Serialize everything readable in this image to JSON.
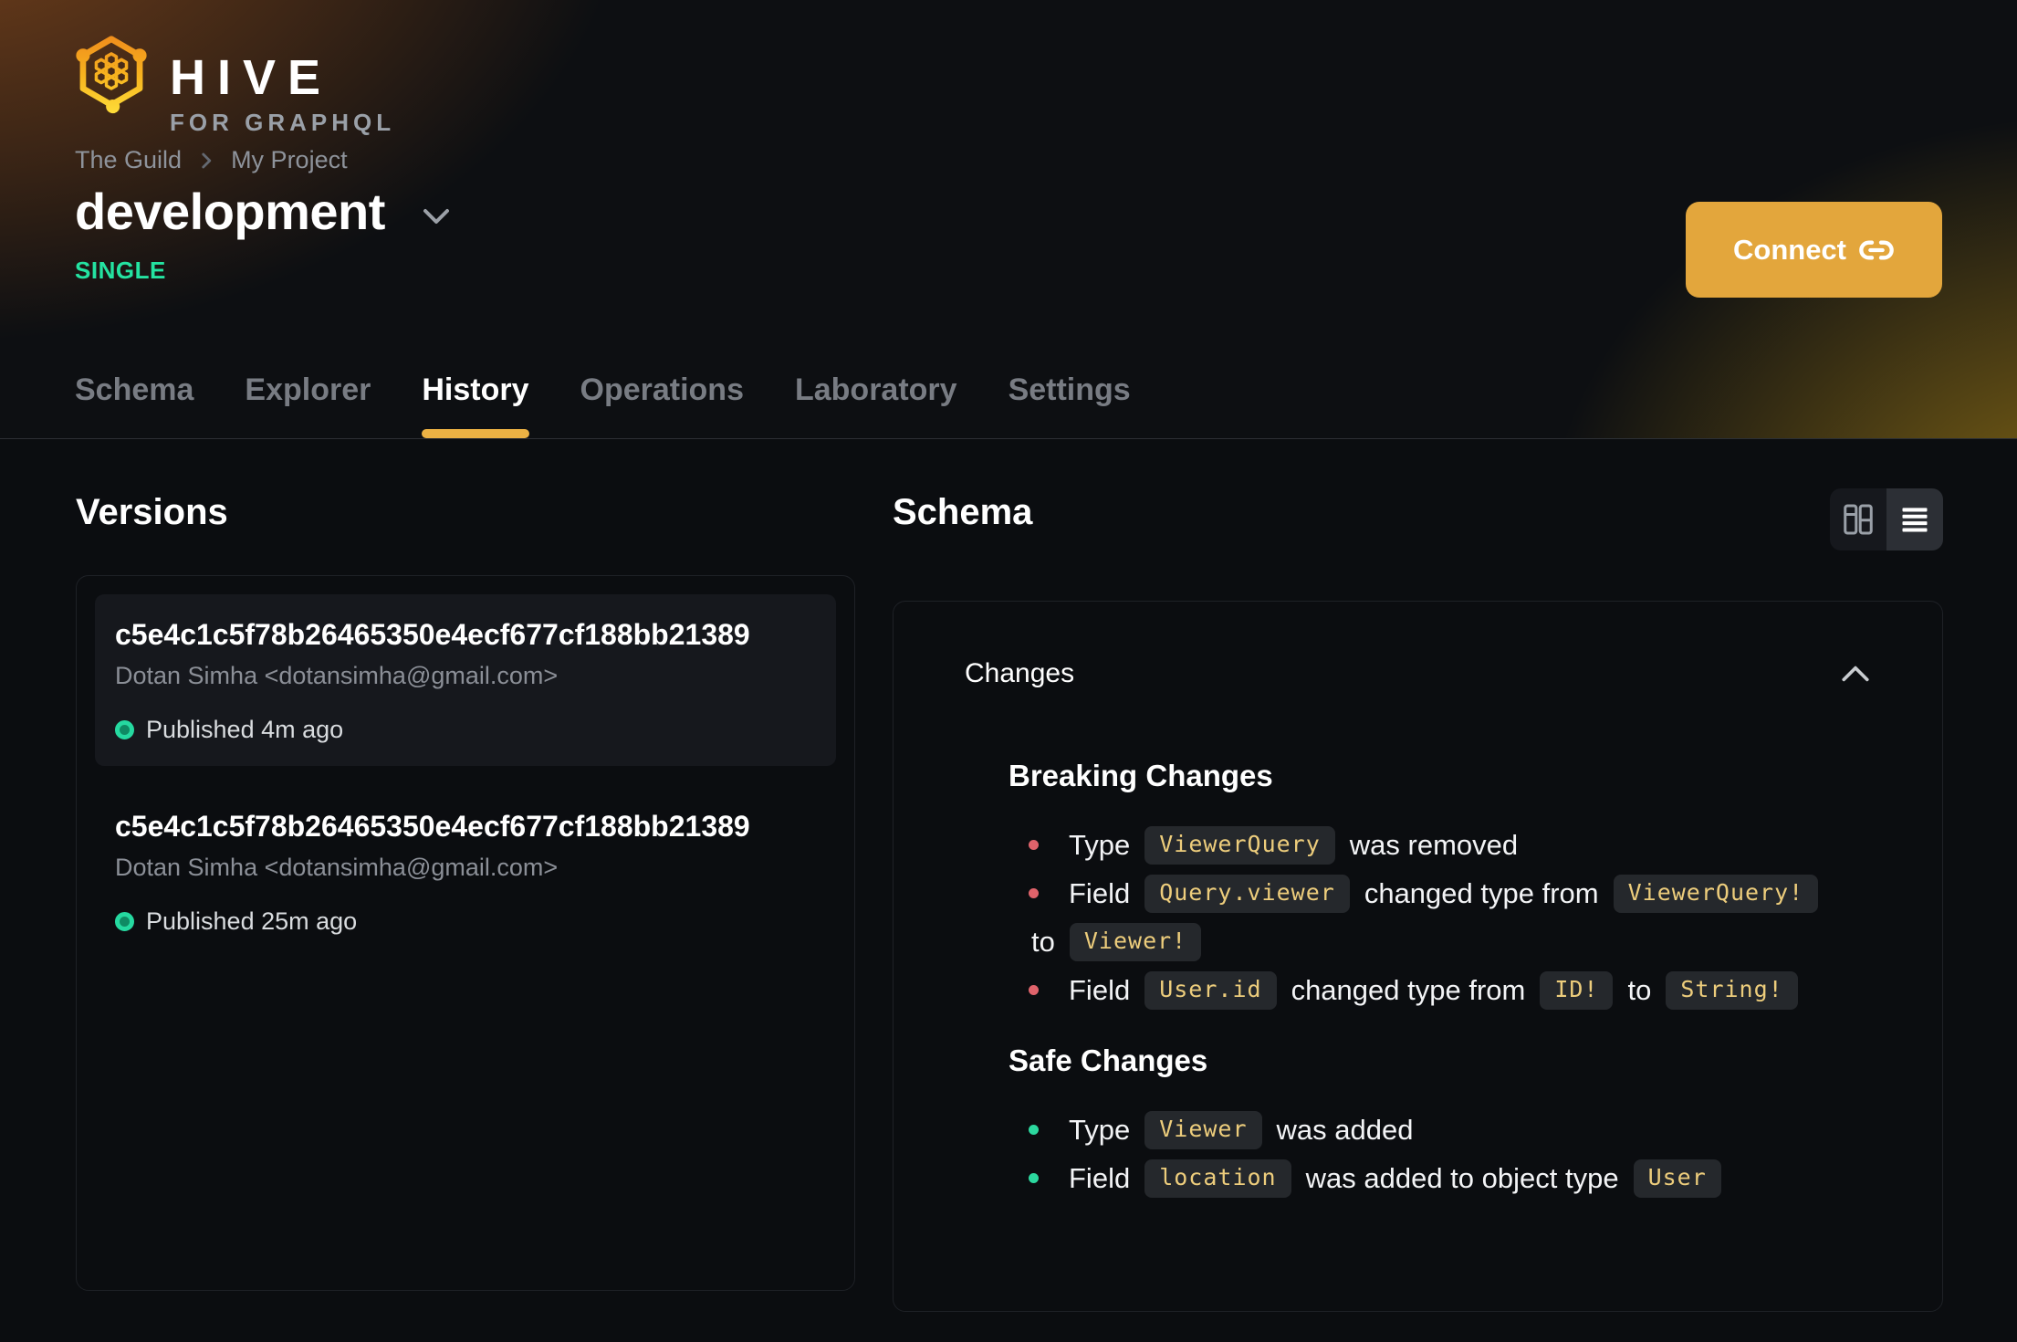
{
  "header": {
    "logo": {
      "title": "HIVE",
      "subtitle": "FOR GRAPHQL"
    },
    "breadcrumb": {
      "org": "The Guild",
      "project": "My Project"
    },
    "target_name": "development",
    "target_badge": "SINGLE",
    "connect_label": "Connect",
    "active_tab": "History",
    "tabs": [
      {
        "label": "Schema"
      },
      {
        "label": "Explorer"
      },
      {
        "label": "History"
      },
      {
        "label": "Operations"
      },
      {
        "label": "Laboratory"
      },
      {
        "label": "Settings"
      }
    ]
  },
  "versions": {
    "title": "Versions",
    "items": [
      {
        "hash": "c5e4c1c5f78b26465350e4ecf677cf188bb21389",
        "author": "Dotan Simha <dotansimha@gmail.com>",
        "status": "Published 4m ago",
        "highlighted": true
      },
      {
        "hash": "c5e4c1c5f78b26465350e4ecf677cf188bb21389",
        "author": "Dotan Simha <dotansimha@gmail.com>",
        "status": "Published 25m ago",
        "highlighted": false
      }
    ]
  },
  "schema_panel": {
    "title": "Schema",
    "view_toggle": {
      "options": [
        "split-view",
        "list-view"
      ],
      "selected": "list-view"
    },
    "changes": {
      "header": "Changes",
      "breaking": {
        "title": "Breaking Changes",
        "items": [
          {
            "t1": "Type",
            "code1": "ViewerQuery",
            "t2": "was removed"
          },
          {
            "t1": "Field",
            "code1": "Query.viewer",
            "t2": "changed type from",
            "code2": "ViewerQuery!",
            "t3": "to",
            "code3": "Viewer!"
          },
          {
            "t1": "Field",
            "code1": "User.id",
            "t2": "changed type from",
            "code2": "ID!",
            "t3": "to",
            "code3": "String!"
          }
        ]
      },
      "safe": {
        "title": "Safe Changes",
        "items": [
          {
            "t1": "Type",
            "code1": "Viewer",
            "t2": "was added"
          },
          {
            "t1": "Field",
            "code1": "location",
            "t2": "was added to object type",
            "code2": "User"
          }
        ]
      }
    }
  },
  "colors": {
    "accent_amber": "#e3a63c",
    "tab_indicator": "#ecb244",
    "badge_green": "#24e3a1",
    "published_dot": "#25d9a0",
    "breaking_bullet": "#e0636b",
    "safe_bullet": "#2cd89f",
    "code_text": "#edcd7c",
    "page_background": "#0b0d10"
  }
}
